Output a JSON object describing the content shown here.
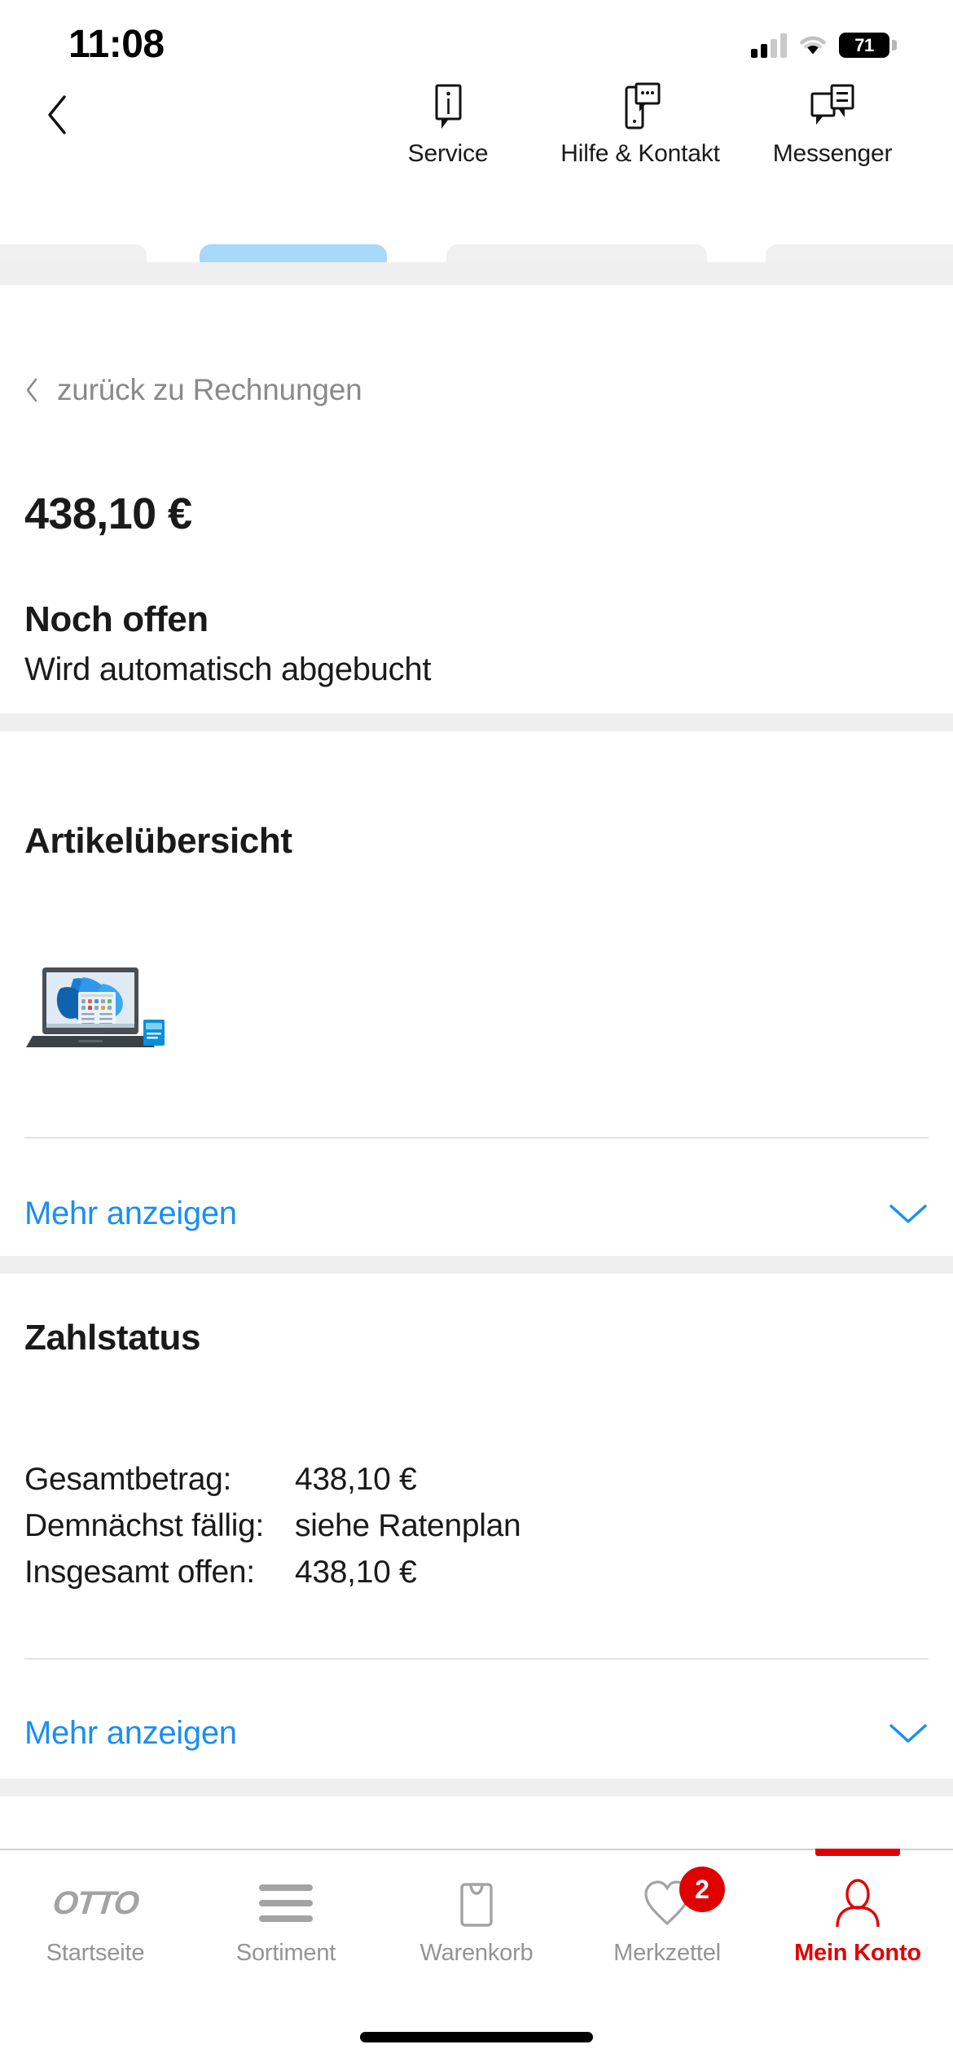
{
  "status_bar": {
    "time": "11:08",
    "battery_percent": "71",
    "signal_icon": "cellular-signal-icon",
    "wifi_icon": "wifi-icon",
    "battery_icon": "battery-icon"
  },
  "top_nav": {
    "back_icon": "chevron-left-icon",
    "items": [
      {
        "label": "Service",
        "icon": "info-speech-bubble-icon"
      },
      {
        "label": "Hilfe & Kontakt",
        "icon": "phone-chat-icon"
      },
      {
        "label": "Messenger",
        "icon": "messenger-bubbles-icon"
      }
    ]
  },
  "breadcrumb": {
    "label": "zurück zu Rechnungen",
    "icon": "chevron-left-icon"
  },
  "summary": {
    "amount": "438,10 €",
    "status": "Noch offen",
    "status_detail": "Wird automatisch abgebucht"
  },
  "articles": {
    "title": "Artikelübersicht",
    "product_alt": "laptop-product-image",
    "more_label": "Mehr anzeigen",
    "more_icon": "chevron-down-icon"
  },
  "payment": {
    "title": "Zahlstatus",
    "rows": [
      {
        "key": "Gesamtbetrag:",
        "value": "438,10 €"
      },
      {
        "key": "Demnächst fällig:",
        "value": "siehe Ratenplan"
      },
      {
        "key": "Insgesamt offen:",
        "value": "438,10 €"
      }
    ],
    "more_label": "Mehr anzeigen",
    "more_icon": "chevron-down-icon"
  },
  "tab_bar": {
    "items": [
      {
        "label": "Startseite",
        "icon": "otto-logo-icon",
        "active": false
      },
      {
        "label": "Sortiment",
        "icon": "hamburger-menu-icon",
        "active": false
      },
      {
        "label": "Warenkorb",
        "icon": "shopping-bag-icon",
        "active": false
      },
      {
        "label": "Merkzettel",
        "icon": "heart-icon",
        "active": false,
        "badge": "2"
      },
      {
        "label": "Mein Konto",
        "icon": "user-account-icon",
        "active": true
      }
    ]
  },
  "colors": {
    "link_blue": "#1a8ef5",
    "brand_red": "#e10000",
    "text_dark": "#1a1a1a",
    "muted_gray": "#8a8a8a",
    "band_gray": "#efefef"
  }
}
